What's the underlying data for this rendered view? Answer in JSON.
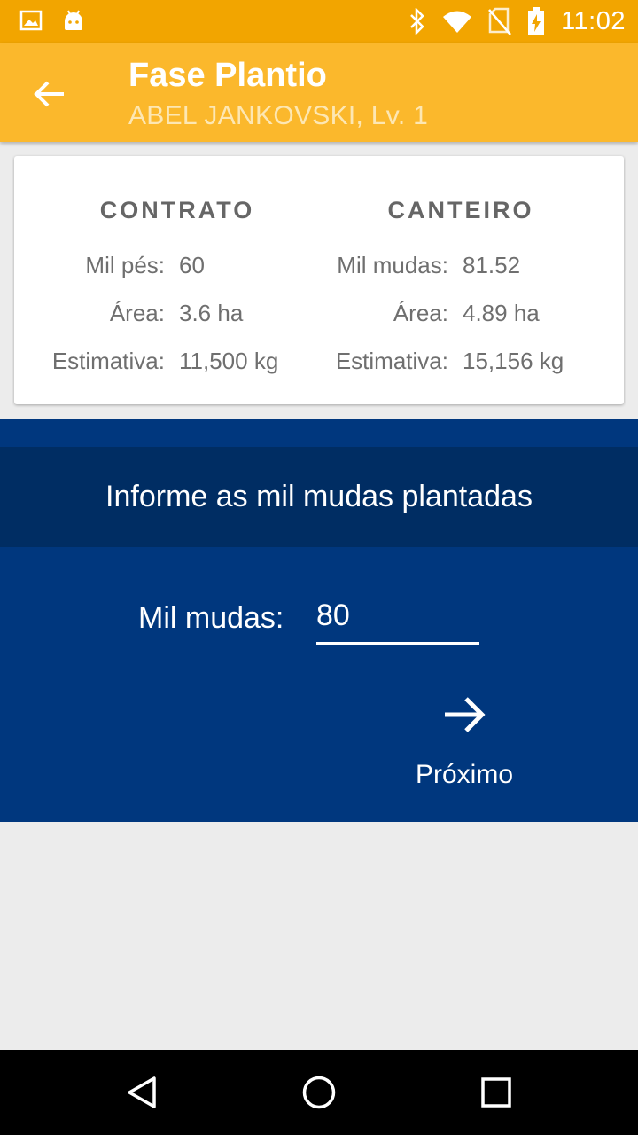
{
  "status_bar": {
    "time": "11:02",
    "icons": [
      "image-notification-icon",
      "android-notification-icon",
      "bluetooth-icon",
      "wifi-icon",
      "no-sim-icon",
      "battery-charging-icon"
    ]
  },
  "app_bar": {
    "title": "Fase Plantio",
    "subtitle": "ABEL JANKOVSKI, Lv. 1"
  },
  "summary": {
    "contrato": {
      "title": "CONTRATO",
      "rows": [
        {
          "label": "Mil pés:",
          "value": "60"
        },
        {
          "label": "Área:",
          "value": "3.6 ha"
        },
        {
          "label": "Estimativa:",
          "value": "11,500 kg"
        }
      ]
    },
    "canteiro": {
      "title": "CANTEIRO",
      "rows": [
        {
          "label": "Mil mudas:",
          "value": "81.52"
        },
        {
          "label": "Área:",
          "value": "4.89 ha"
        },
        {
          "label": "Estimativa:",
          "value": "15,156 kg"
        }
      ]
    }
  },
  "form": {
    "prompt": "Informe as mil mudas plantadas",
    "field_label": "Mil mudas:",
    "field_value": "80",
    "next_label": "Próximo"
  },
  "colors": {
    "status_bar": "#f2a500",
    "app_bar": "#fbb82c",
    "panel": "#00377e",
    "prompt_band": "#002d63"
  }
}
